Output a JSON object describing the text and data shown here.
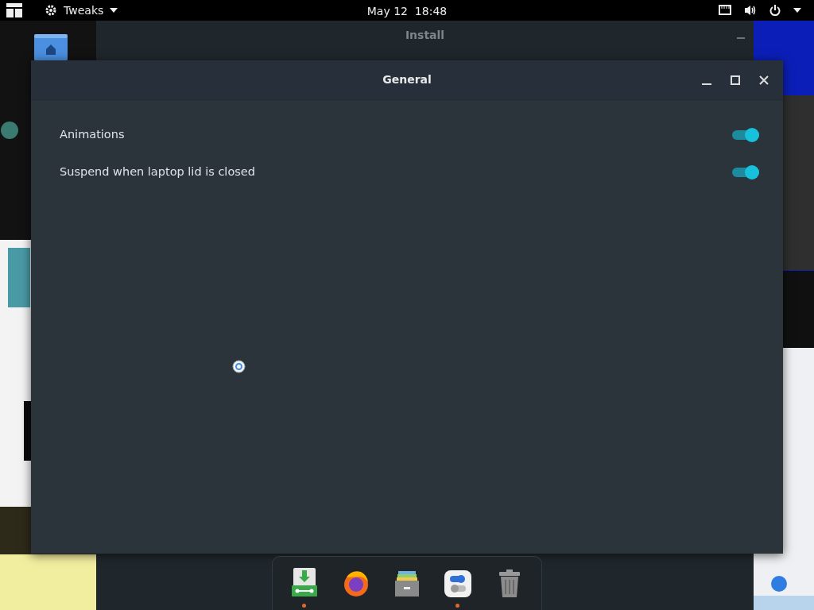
{
  "top_bar": {
    "app_menu": "Tweaks",
    "clock": "May 12  18:48"
  },
  "background_window": {
    "title": "Install"
  },
  "window": {
    "title": "General",
    "settings": [
      {
        "label": "Animations",
        "on": true
      },
      {
        "label": "Suspend when laptop lid is closed",
        "on": true
      }
    ]
  },
  "dock": {
    "items": [
      {
        "kind": "installer",
        "running": true
      },
      {
        "kind": "browser",
        "running": false
      },
      {
        "kind": "files",
        "running": false
      },
      {
        "kind": "tweaks",
        "running": true
      },
      {
        "kind": "trash",
        "running": false
      }
    ]
  }
}
